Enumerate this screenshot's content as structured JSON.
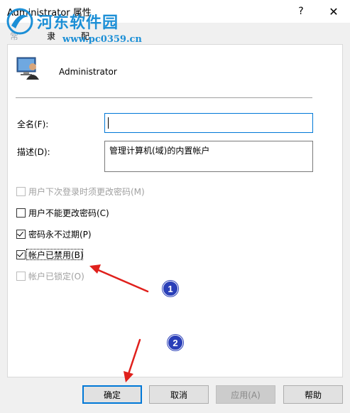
{
  "window": {
    "title": "Administrator 属性",
    "help_glyph": "?",
    "close_glyph": "✕"
  },
  "watermark": {
    "title": "河东软件园",
    "url": "www.pc0359.cn"
  },
  "tabs": [
    {
      "label": "常规"
    },
    {
      "label": "隶属于"
    },
    {
      "label": "配置文件"
    }
  ],
  "user": {
    "name": "Administrator",
    "icon": "user-monitor-icon"
  },
  "form": {
    "fullname_label": "全名(F):",
    "fullname_value": "",
    "description_label": "描述(D):",
    "description_value": "管理计算机(域)的内置帐户"
  },
  "options": [
    {
      "label": "用户下次登录时须更改密码(M)",
      "checked": false,
      "enabled": false
    },
    {
      "label": "用户不能更改密码(C)",
      "checked": false,
      "enabled": true
    },
    {
      "label": "密码永不过期(P)",
      "checked": true,
      "enabled": true
    },
    {
      "label": "帐户已禁用(B)",
      "checked": true,
      "enabled": true
    },
    {
      "label": "帐户已锁定(O)",
      "checked": false,
      "enabled": false
    }
  ],
  "annotations": {
    "badge1": "1",
    "badge2": "2",
    "arrow_color": "#e0201c"
  },
  "buttons": {
    "ok": "确定",
    "cancel": "取消",
    "apply": "应用(A)",
    "help": "帮助"
  },
  "colors": {
    "accent": "#0078d7",
    "watermark": "#1c8fd6",
    "badge": "#2a3fb8"
  }
}
